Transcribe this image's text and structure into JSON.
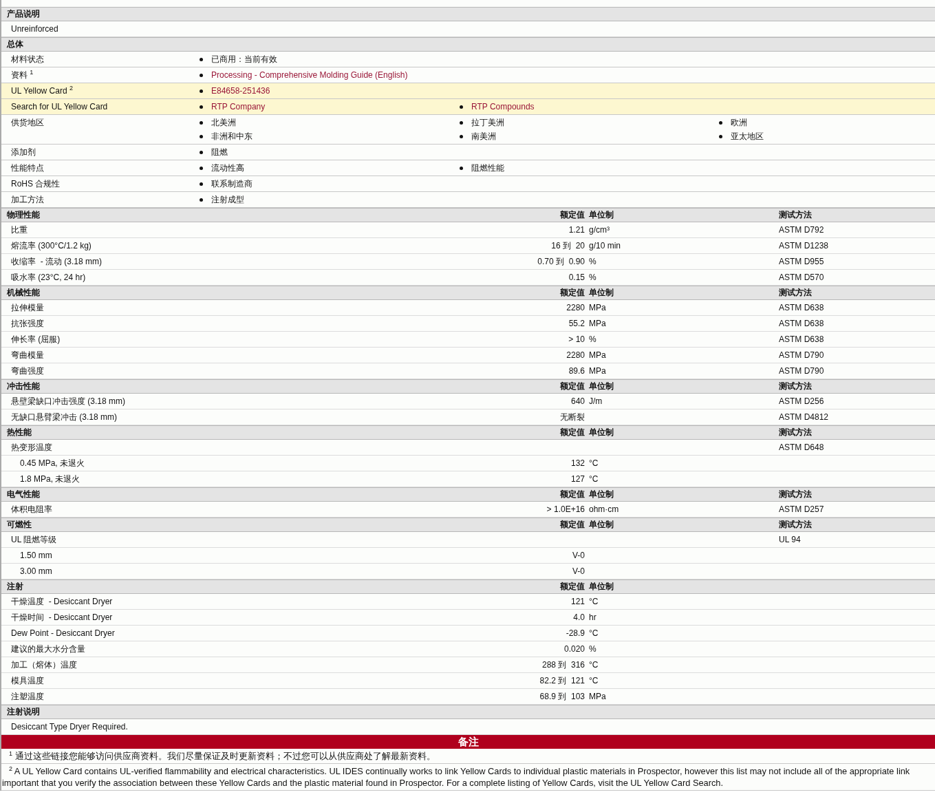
{
  "sections": [
    {
      "kind": "text",
      "title": "产品说明",
      "rows": [
        {
          "text": "Unreinforced"
        }
      ]
    },
    {
      "kind": "general",
      "title": "总体",
      "rows": [
        {
          "label": "材料状态",
          "highlight": false,
          "items": [
            {
              "text": "已商用：当前有效",
              "link": false
            }
          ]
        },
        {
          "label": "资料 $^{1}$",
          "highlight": false,
          "items": [
            {
              "text": "Processing - Comprehensive Molding Guide (English)",
              "link": true
            }
          ]
        },
        {
          "label": "UL Yellow Card $^{2}$",
          "highlight": true,
          "items": [
            {
              "text": "E84658-251436",
              "link": true
            }
          ]
        },
        {
          "label": "Search for UL Yellow Card",
          "highlight": true,
          "items": [
            {
              "text": "RTP Company",
              "link": true
            },
            {
              "text": "RTP Compounds",
              "link": true
            }
          ]
        },
        {
          "label": "供货地区",
          "highlight": false,
          "items": [
            {
              "text": "北美洲",
              "link": false
            },
            {
              "text": "拉丁美洲",
              "link": false
            },
            {
              "text": "欧洲",
              "link": false
            },
            {
              "text": "非洲和中东",
              "link": false
            },
            {
              "text": "南美洲",
              "link": false
            },
            {
              "text": "亚太地区",
              "link": false
            }
          ]
        },
        {
          "label": "添加剂",
          "highlight": false,
          "items": [
            {
              "text": "阻燃",
              "link": false
            }
          ]
        },
        {
          "label": "性能特点",
          "highlight": false,
          "items": [
            {
              "text": "流动性高",
              "link": false
            },
            {
              "text": "阻燃性能",
              "link": false
            }
          ]
        },
        {
          "label": "RoHS 合规性",
          "highlight": false,
          "items": [
            {
              "text": "联系制造商",
              "link": false
            }
          ]
        },
        {
          "label": "加工方法",
          "highlight": false,
          "items": [
            {
              "text": "注射成型",
              "link": false
            }
          ]
        }
      ]
    },
    {
      "kind": "properties",
      "title": "物理性能",
      "headers": {
        "value": "额定值",
        "unit": "单位制",
        "method": "测试方法"
      },
      "rows": [
        {
          "label": "比重",
          "value": "1.21",
          "unit": "g/cm³",
          "method": "ASTM D792"
        },
        {
          "label": "熔流率 (300°C/1.2 kg)",
          "value": "16 到  20",
          "unit": "g/10 min",
          "method": "ASTM D1238"
        },
        {
          "label": "收缩率  - 流动 (3.18 mm)",
          "value": "0.70 到  0.90",
          "unit": "%",
          "method": "ASTM D955"
        },
        {
          "label": "吸水率 (23°C, 24 hr)",
          "value": "0.15",
          "unit": "%",
          "method": "ASTM D570"
        }
      ]
    },
    {
      "kind": "properties",
      "title": "机械性能",
      "headers": {
        "value": "额定值",
        "unit": "单位制",
        "method": "测试方法"
      },
      "rows": [
        {
          "label": "拉伸模量",
          "value": "2280",
          "unit": "MPa",
          "method": "ASTM D638"
        },
        {
          "label": "抗张强度",
          "value": "55.2",
          "unit": "MPa",
          "method": "ASTM D638"
        },
        {
          "label": "伸长率 (屈服)",
          "value": "> 10",
          "unit": "%",
          "method": "ASTM D638"
        },
        {
          "label": "弯曲模量",
          "value": "2280",
          "unit": "MPa",
          "method": "ASTM D790"
        },
        {
          "label": "弯曲强度",
          "value": "89.6",
          "unit": "MPa",
          "method": "ASTM D790"
        }
      ]
    },
    {
      "kind": "properties",
      "title": "冲击性能",
      "headers": {
        "value": "额定值",
        "unit": "单位制",
        "method": "测试方法"
      },
      "rows": [
        {
          "label": "悬壁梁缺口冲击强度 (3.18 mm)",
          "value": "640",
          "unit": "J/m",
          "method": "ASTM D256"
        },
        {
          "label": "无缺口悬臂梁冲击 (3.18 mm)",
          "value": "无断裂",
          "method": "ASTM D4812"
        }
      ]
    },
    {
      "kind": "properties",
      "title": "热性能",
      "headers": {
        "value": "额定值",
        "unit": "单位制",
        "method": "测试方法"
      },
      "rows": [
        {
          "label": "热变形温度",
          "method": "ASTM D648",
          "children": [
            {
              "label": "0.45 MPa, 未退火",
              "value": "132",
              "unit": "°C"
            },
            {
              "label": "1.8 MPa, 未退火",
              "value": "127",
              "unit": "°C"
            }
          ]
        }
      ]
    },
    {
      "kind": "properties",
      "title": "电气性能",
      "headers": {
        "value": "额定值",
        "unit": "单位制",
        "method": "测试方法"
      },
      "rows": [
        {
          "label": "体积电阻率",
          "value": "> 1.0E+16",
          "unit": "ohm·cm",
          "method": "ASTM D257"
        }
      ]
    },
    {
      "kind": "properties",
      "title": "可燃性",
      "headers": {
        "value": "额定值",
        "unit": "单位制",
        "method": "测试方法"
      },
      "rows": [
        {
          "label": "UL 阻燃等级",
          "method": "UL 94",
          "children": [
            {
              "label": "1.50 mm",
              "value": "V-0"
            },
            {
              "label": "3.00 mm",
              "value": "V-0"
            }
          ]
        }
      ]
    },
    {
      "kind": "properties",
      "title": "注射",
      "headers": {
        "value": "额定值",
        "unit": "单位制"
      },
      "rows": [
        {
          "label": "干燥温度  - Desiccant Dryer",
          "value": "121",
          "unit": "°C"
        },
        {
          "label": "干燥时间  - Desiccant Dryer",
          "value": "4.0",
          "unit": "hr"
        },
        {
          "label": "Dew Point - Desiccant Dryer",
          "value": "-28.9",
          "unit": "°C"
        },
        {
          "label": "建议的最大水分含量",
          "value": "0.020",
          "unit": "%"
        },
        {
          "label": "加工（熔体）温度",
          "value": "288 到  316",
          "unit": "°C"
        },
        {
          "label": "模具温度",
          "value": "82.2 到  121",
          "unit": "°C"
        },
        {
          "label": "注塑温度",
          "value": "68.9 到  103",
          "unit": "MPa"
        }
      ]
    },
    {
      "kind": "text",
      "title": "注射说明",
      "rows": [
        {
          "text": "Desiccant Type Dryer Required."
        }
      ]
    }
  ],
  "notes": {
    "title": "备注",
    "footnotes": [
      {
        "mark": "1",
        "lines": [
          "通过这些链接您能够访问供应商资料。我们尽量保证及时更新资料；不过您可以从供应商处了解最新资料。"
        ]
      },
      {
        "mark": "2",
        "lines": [
          "A UL Yellow Card contains UL-verified flammability and electrical characteristics. UL IDES continually works to link Yellow Cards to individual plastic materials in Prospector, however this list may not include all of the appropriate link",
          "important that you verify the association between these Yellow Cards and the plastic material found in Prospector. For a complete listing of Yellow Cards, visit the UL Yellow Card Search."
        ]
      }
    ]
  }
}
